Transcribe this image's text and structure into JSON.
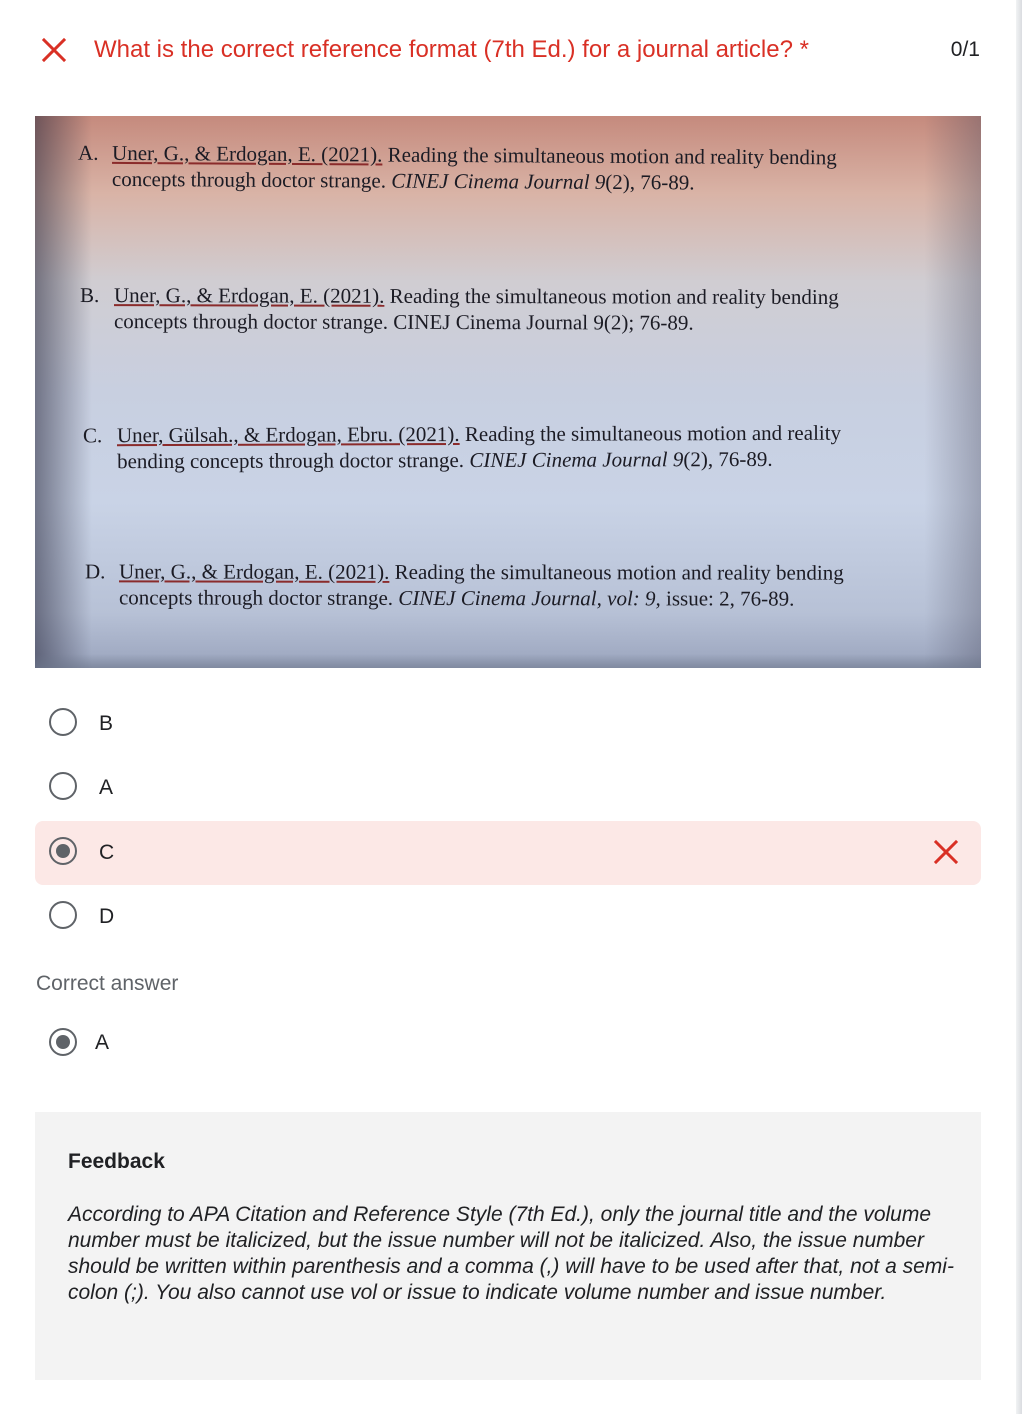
{
  "question": {
    "title": "What is the correct reference format (7th Ed.) for a journal article? *",
    "score": "0/1",
    "status_icon": "close-icon",
    "status_color": "#d93025"
  },
  "image_references": {
    "a": {
      "letter": "A.",
      "authors": "Uner, G., & Erdogan, E. (2021).",
      "title_l1": "Reading the simultaneous motion and reality bending",
      "title_l2": "concepts through doctor strange.",
      "journal": "CINEJ Cinema Journal 9",
      "issue": "(2), 76-89."
    },
    "b": {
      "letter": "B.",
      "authors": "Uner, G., & Erdogan, E. (2021).",
      "title_l1": "Reading the simultaneous motion and reality bending",
      "line2": "concepts through doctor strange. CINEJ Cinema Journal 9(2); 76-89."
    },
    "c": {
      "letter": "C.",
      "authors": "Uner, Gülsah., & Erdogan, Ebru. (2021).",
      "title_l1": "Reading the simultaneous motion and reality",
      "title_l2": "bending concepts through doctor strange.",
      "journal": "CINEJ Cinema Journal 9",
      "issue": "(2), 76-89."
    },
    "d": {
      "letter": "D.",
      "authors": "Uner, G., & Erdogan, E. (2021).",
      "title_l1": "Reading the simultaneous motion and reality bending",
      "title_l2": "concepts through doctor strange.",
      "journal": "CINEJ Cinema Journal, vol: 9,",
      "issue": "issue: 2, 76-89."
    }
  },
  "options": [
    {
      "label": "B",
      "selected": false
    },
    {
      "label": "A",
      "selected": false
    },
    {
      "label": "C",
      "selected": true,
      "wrong": true
    },
    {
      "label": "D",
      "selected": false
    }
  ],
  "correct": {
    "title": "Correct answer",
    "answer": "A"
  },
  "feedback": {
    "title": "Feedback",
    "text": "According to APA Citation and Reference Style (7th Ed.), only the journal title and the volume number must be italicized, but the issue number will not be italicized. Also, the issue number should be written within parenthesis and a comma (,) will have to be used after that, not a semi-colon (;). You also cannot use vol or issue to indicate volume number and issue number."
  },
  "colors": {
    "wrong_bg": "#fce8e6",
    "wrong_accent": "#d93025",
    "feedback_bg": "#f3f3f3"
  }
}
